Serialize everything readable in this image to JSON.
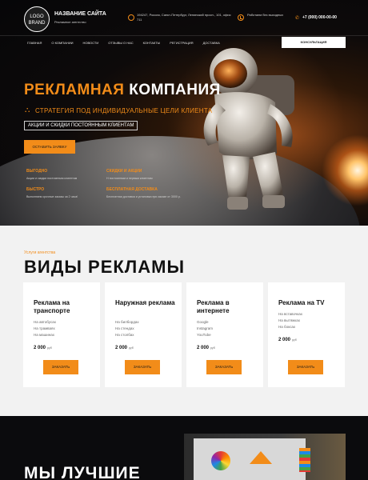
{
  "header": {
    "logo_line1": "LOGO",
    "logo_line2": "BRAND",
    "site_title": "НАЗВАНИЕ САЙТА",
    "site_subtitle": "Рекламное агентство",
    "address": "194247, Россия, Санкт-Петербург, Ленинский просп., 101, офис 711",
    "hours": "Работаем без выходных",
    "phone": "+7 (000) 000-00-00",
    "nav": [
      "Главная",
      "О компании",
      "Новости",
      "Отзывы о нас",
      "Контакты",
      "Регистрация",
      "Доставка"
    ],
    "consult_button": "Консультация"
  },
  "hero": {
    "title_part1": "Рекламная",
    "title_part2": "компания",
    "strategy": "Стратегия под индивидуальные цели клиента",
    "promo": "Акции и скидки постоянным клиентам",
    "order_button": "Оставить заявку",
    "features": [
      {
        "title": "Выгодно",
        "text": "Акции и скидки постоянным клиентам"
      },
      {
        "title": "Скидки и акции",
        "text": "Н постоянным и первым клиентам"
      },
      {
        "title": "Быстро",
        "text": "Выполняем срочные заказы за 2 часа!"
      },
      {
        "title": "Бесплатная доставка",
        "text": "Бесплатная доставка и установка при заказе от 3000 р."
      }
    ]
  },
  "services": {
    "kicker": "Услуги агентства",
    "title": "Виды рекламы",
    "cards": [
      {
        "title": "Реклама на транспорте",
        "items": [
          "На автобусах",
          "На трамваях",
          "На машинах"
        ],
        "price": "2 000",
        "unit": "руб",
        "button": "Заказать"
      },
      {
        "title": "Наружная реклама",
        "items": [
          "На билбордах",
          "На стендах",
          "На столбах"
        ],
        "price": "2 000",
        "unit": "руб",
        "button": "Заказать"
      },
      {
        "title": "Реклама в интернете",
        "items": [
          "Google",
          "Instagram",
          "YouTube"
        ],
        "price": "2 000",
        "unit": "руб",
        "button": "Заказать"
      },
      {
        "title": "Реклама на TV",
        "items": [
          "На вставочках",
          "На вытяжках",
          "На боксах"
        ],
        "price": "2 000",
        "unit": "руб",
        "button": "Заказать"
      }
    ]
  },
  "best": {
    "title": "Мы лучшие"
  },
  "colors": {
    "accent": "#f28c19",
    "dark": "#0b0b0d",
    "light_bg": "#f2f2f2"
  }
}
